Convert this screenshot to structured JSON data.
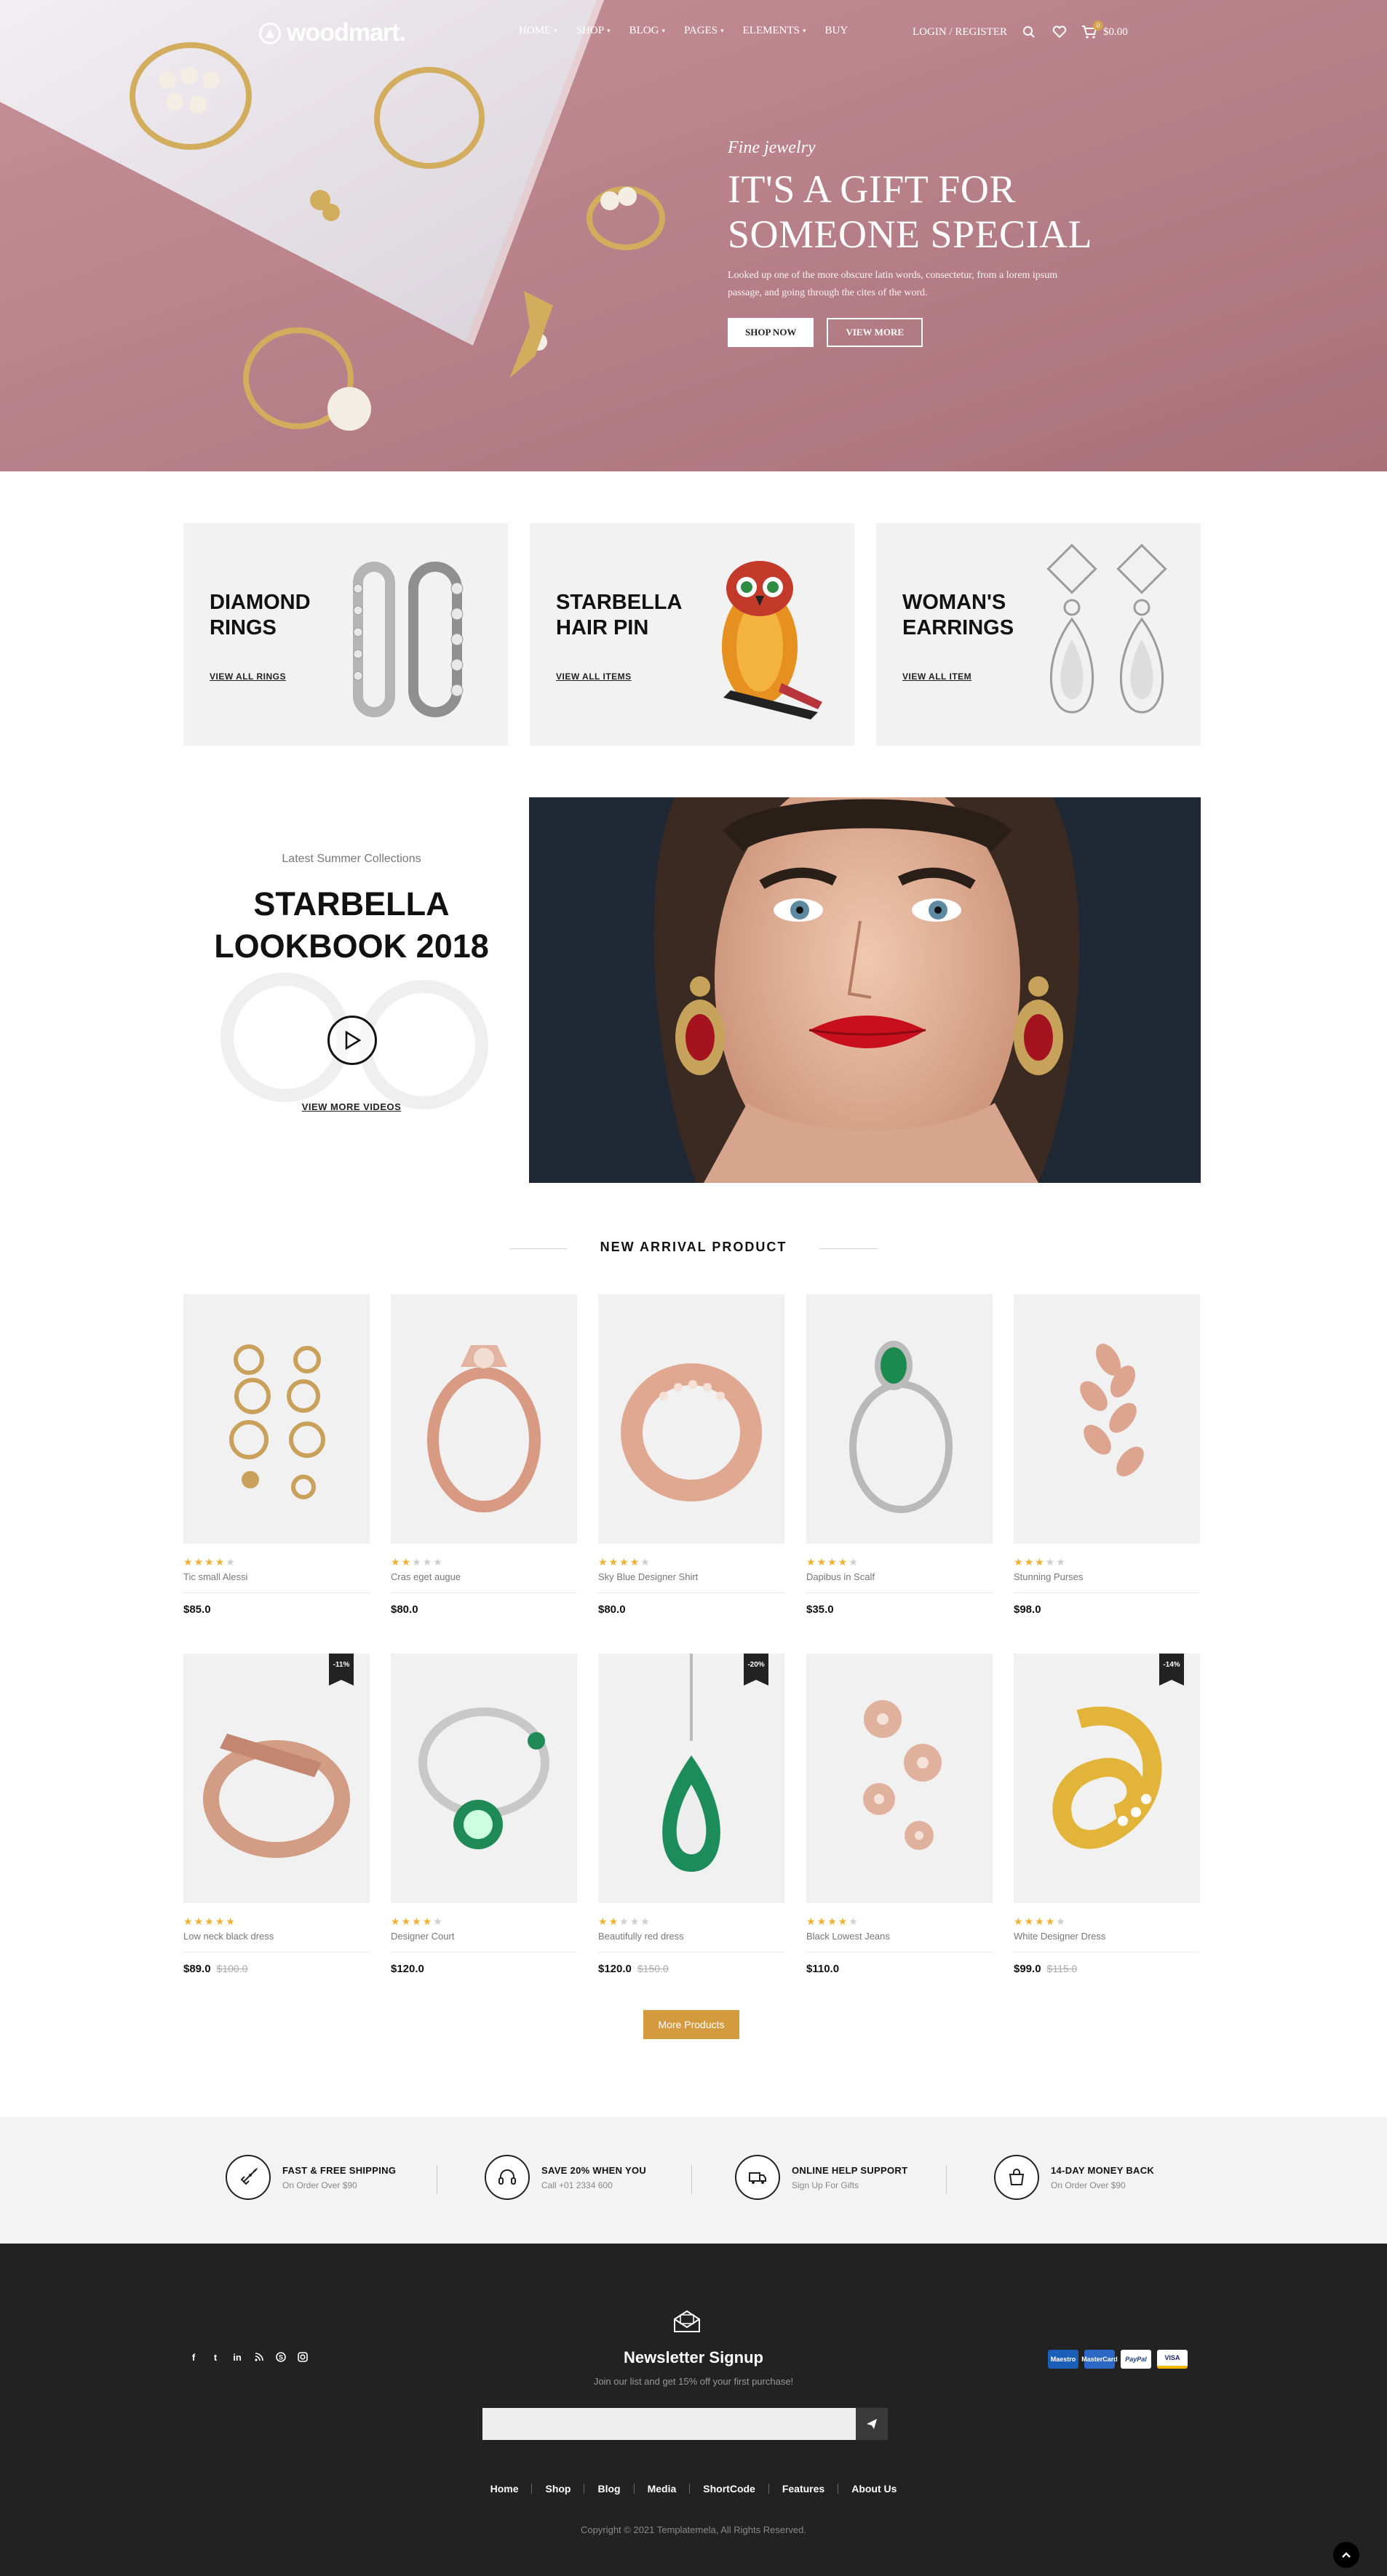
{
  "header": {
    "logo": "woodmart.",
    "nav": [
      {
        "label": "HOME",
        "dropdown": true
      },
      {
        "label": "SHOP",
        "dropdown": true
      },
      {
        "label": "BLOG",
        "dropdown": true
      },
      {
        "label": "PAGES",
        "dropdown": true
      },
      {
        "label": "ELEMENTS",
        "dropdown": true
      },
      {
        "label": "BUY",
        "dropdown": false
      }
    ],
    "login_label": "LOGIN / REGISTER",
    "cart_count": "0",
    "cart_total": "$0.00"
  },
  "hero": {
    "subtitle": "Fine jewelry",
    "title_line1": "IT'S A GIFT FOR",
    "title_line2": "SOMEONE SPECIAL",
    "description": "Looked up one of the more obscure latin words, consectetur, from a lorem ipsum passage, and going through the cites of the word.",
    "btn_primary": "SHOP NOW",
    "btn_secondary": "VIEW MORE"
  },
  "categories": [
    {
      "title": "DIAMOND RINGS",
      "link": "VIEW ALL RINGS"
    },
    {
      "title": "STARBELLA HAIR PIN",
      "link": "VIEW ALL ITEMS"
    },
    {
      "title": "WOMAN'S EARRINGS",
      "link": "VIEW ALL ITEM"
    }
  ],
  "lookbook": {
    "subtitle": "Latest Summer Collections",
    "title_line1": "STARBELLA",
    "title_line2": "LOOKBOOK 2018",
    "link": "VIEW MORE VIDEOS"
  },
  "arrivals": {
    "title": "NEW ARRIVAL PRODUCT",
    "products": [
      {
        "name": "Tic small Alessi",
        "price": "$85.0",
        "old_price": "",
        "rating": 4,
        "badge": ""
      },
      {
        "name": "Cras eget augue",
        "price": "$80.0",
        "old_price": "",
        "rating": 2,
        "badge": ""
      },
      {
        "name": "Sky Blue Designer Shirt",
        "price": "$80.0",
        "old_price": "",
        "rating": 4,
        "badge": ""
      },
      {
        "name": "Dapibus in Scalf",
        "price": "$35.0",
        "old_price": "",
        "rating": 4,
        "badge": ""
      },
      {
        "name": "Stunning Purses",
        "price": "$98.0",
        "old_price": "",
        "rating": 3,
        "badge": ""
      },
      {
        "name": "Low neck black dress",
        "price": "$89.0",
        "old_price": "$100.0",
        "rating": 5,
        "badge": "-11%"
      },
      {
        "name": "Designer Court",
        "price": "$120.0",
        "old_price": "",
        "rating": 4,
        "badge": ""
      },
      {
        "name": "Beautifully red dress",
        "price": "$120.0",
        "old_price": "$150.0",
        "rating": 2,
        "badge": "-20%"
      },
      {
        "name": "Black Lowest Jeans",
        "price": "$110.0",
        "old_price": "",
        "rating": 4,
        "badge": ""
      },
      {
        "name": "White Designer Dress",
        "price": "$99.0",
        "old_price": "$115.0",
        "rating": 4,
        "badge": "-14%"
      }
    ],
    "more_label": "More Products"
  },
  "features": [
    {
      "title": "FAST & FREE SHIPPING",
      "sub": "On Order Over $90",
      "icon": "rocket-icon"
    },
    {
      "title": "SAVE 20% WHEN YOU",
      "sub": "Call +01 2334 600",
      "icon": "headset-icon"
    },
    {
      "title": "ONLINE HELP SUPPORT",
      "sub": "Sign Up For Gifts",
      "icon": "truck-icon"
    },
    {
      "title": "14-DAY MONEY BACK",
      "sub": "On Order Over $90",
      "icon": "bag-icon"
    }
  ],
  "footer": {
    "social": [
      "f",
      "t",
      "in",
      "rss",
      "s",
      "ig"
    ],
    "newsletter_title": "Newsletter Signup",
    "newsletter_desc": "Join our list and get 15% off your first purchase!",
    "email_placeholder": "",
    "payment_cards": [
      "Maestro",
      "MasterCard",
      "PayPal",
      "VISA"
    ],
    "links": [
      "Home",
      "Shop",
      "Blog",
      "Media",
      "ShortCode",
      "Features",
      "About Us"
    ],
    "copyright": "Copyright © 2021 Templatemela, All Rights Reserved."
  },
  "colors": {
    "hero_bg": "#b87b85",
    "accent": "#d49a3e",
    "star": "#f0b032",
    "footer_bg": "#222222"
  }
}
